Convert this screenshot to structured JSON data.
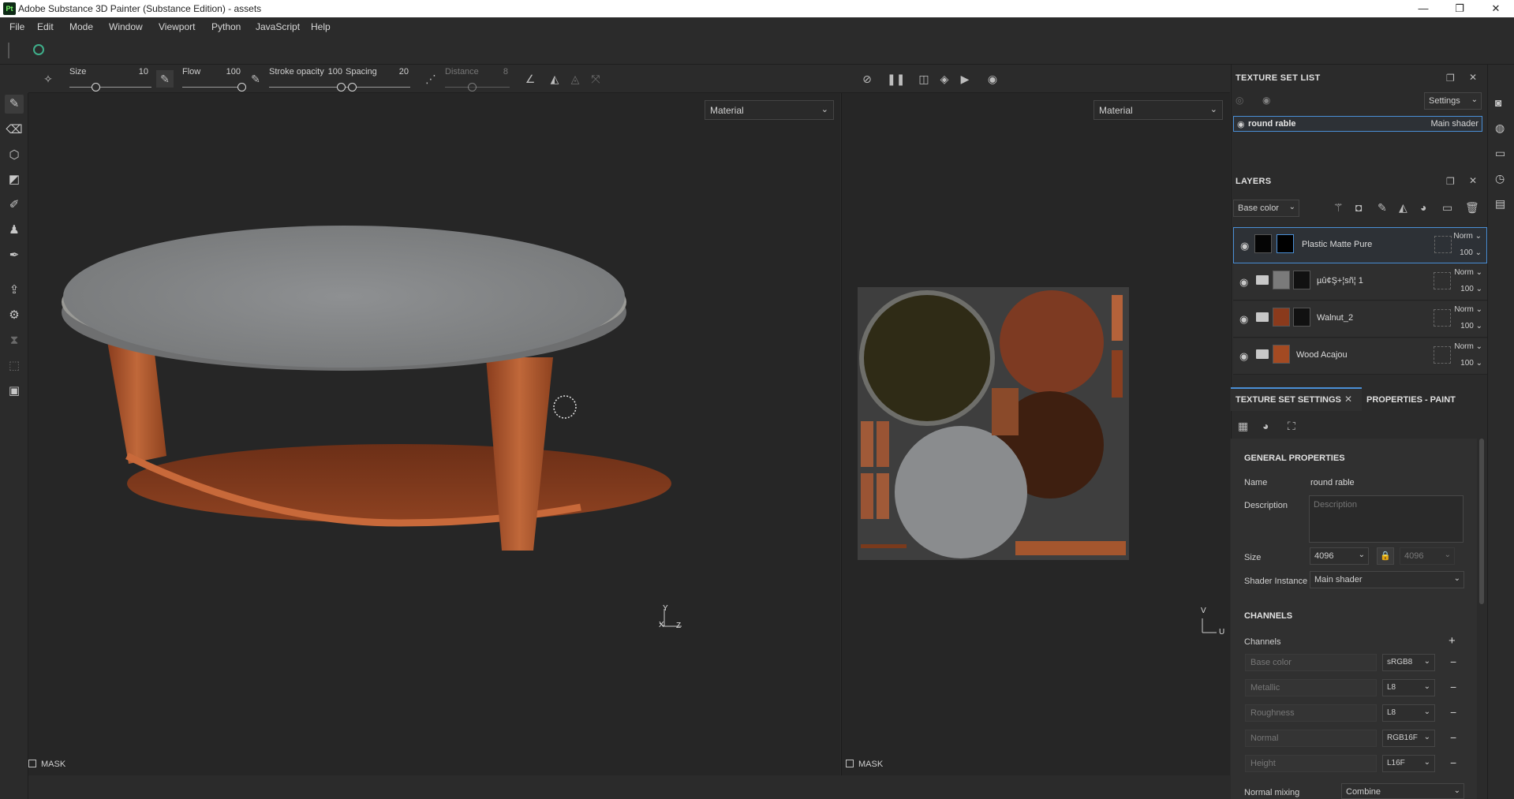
{
  "window": {
    "title": "Adobe Substance 3D Painter (Substance Edition) - assets",
    "logo": "Pt",
    "controls": {
      "minimize": "—",
      "maximize": "❐",
      "close": "✕"
    }
  },
  "menu": [
    "File",
    "Edit",
    "Mode",
    "Window",
    "Viewport",
    "Python",
    "JavaScript",
    "Help"
  ],
  "tool_options": {
    "size": {
      "label": "Size",
      "value": "10",
      "level": 0.15
    },
    "flow": {
      "label": "Flow",
      "value": "100",
      "level": 1.0
    },
    "stroke_opacity": {
      "label": "Stroke opacity",
      "value": "100",
      "level": 1.0
    },
    "spacing": {
      "label": "Spacing",
      "value": "20",
      "level": 0.03
    },
    "distance": {
      "label": "Distance",
      "value": "8",
      "level": 0.4
    }
  },
  "viewport3d": {
    "channel": "Material",
    "mask_label": "MASK",
    "axes": {
      "y": "Y",
      "x": "X",
      "z": "Z"
    }
  },
  "viewport2d": {
    "channel": "Material",
    "mask_label": "MASK",
    "axes": {
      "v": "V",
      "u": "U"
    }
  },
  "texture_set_list": {
    "title": "TEXTURE SET LIST",
    "settings_label": "Settings",
    "item": {
      "name": "round rable",
      "shader": "Main shader"
    }
  },
  "layers": {
    "title": "LAYERS",
    "channel": "Base color",
    "items": [
      {
        "name": "Plastic Matte Pure",
        "blend": "Norm",
        "opacity": "100",
        "selected": true
      },
      {
        "name": "µû¢Ş+¦sñ¦ 1",
        "blend": "Norm",
        "opacity": "100"
      },
      {
        "name": "Walnut_2",
        "blend": "Norm",
        "opacity": "100"
      },
      {
        "name": "Wood Acajou",
        "blend": "Norm",
        "opacity": "100"
      }
    ]
  },
  "tabs": {
    "active": "TEXTURE SET SETTINGS",
    "other": "PROPERTIES - PAINT"
  },
  "general_properties": {
    "title": "GENERAL PROPERTIES",
    "name_label": "Name",
    "name_value": "round rable",
    "description_label": "Description",
    "description_placeholder": "Description",
    "size_label": "Size",
    "size_value": "4096",
    "size_linked_value": "4096",
    "shader_label": "Shader Instance",
    "shader_value": "Main shader"
  },
  "channels": {
    "title": "CHANNELS",
    "label": "Channels",
    "add": "+",
    "items": [
      {
        "name": "Base color",
        "format": "sRGB8"
      },
      {
        "name": "Metallic",
        "format": "L8"
      },
      {
        "name": "Roughness",
        "format": "L8"
      },
      {
        "name": "Normal",
        "format": "RGB16F"
      },
      {
        "name": "Height",
        "format": "L16F"
      }
    ],
    "normal_mixing_label": "Normal mixing",
    "normal_mixing_value": "Combine"
  },
  "colors": {
    "accent": "#4a8fd6",
    "panel_bg": "#2b2b2b",
    "viewport_bg": "#262626",
    "table_top": "#8a8c8e",
    "wood": "#b25a2c"
  }
}
